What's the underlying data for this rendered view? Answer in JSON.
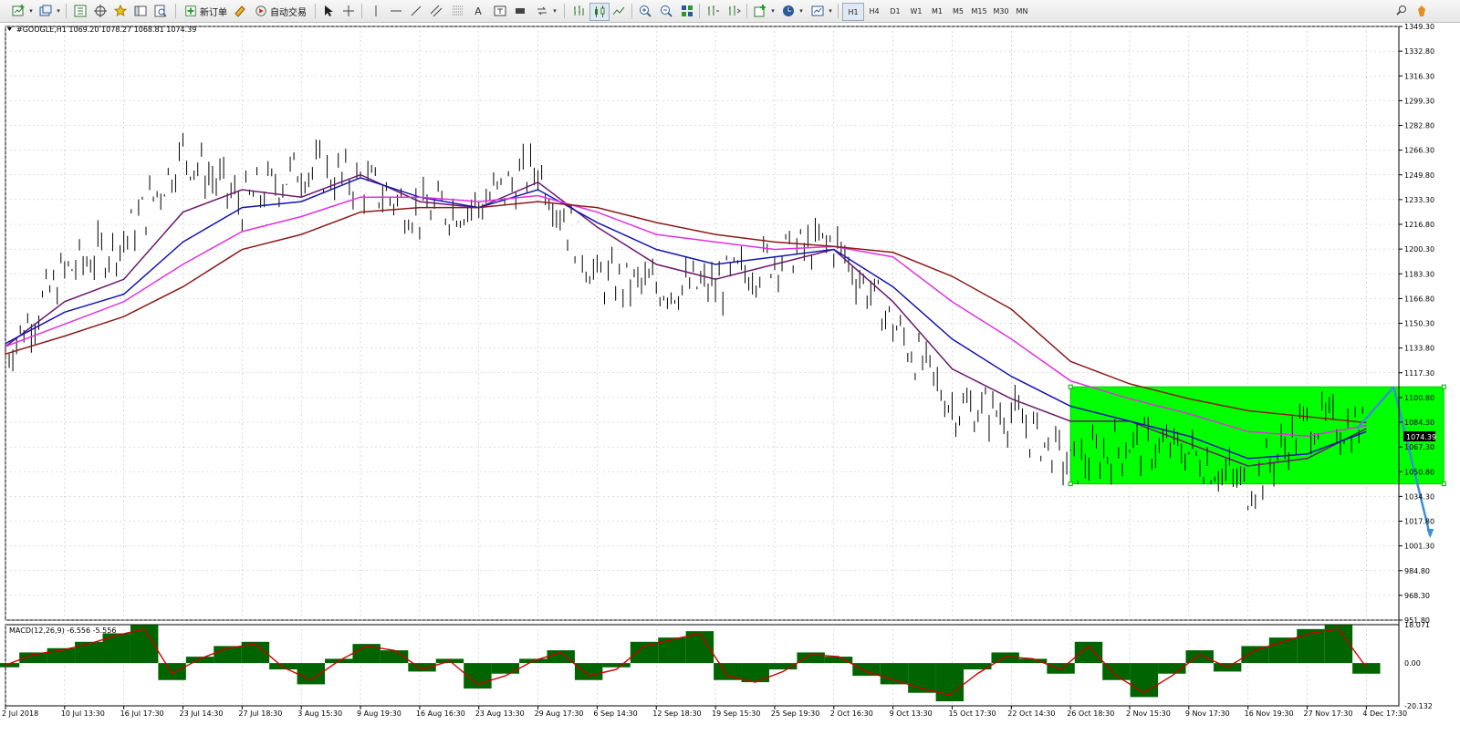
{
  "toolbar": {
    "new_order": "新订单",
    "auto_trading": "自动交易",
    "timeframes": [
      "H1",
      "H4",
      "D1",
      "W1",
      "M1",
      "M5",
      "M15",
      "M30",
      "MN"
    ],
    "active_timeframe": "H1"
  },
  "chart_legend": "#GOOGLE,H1  1069.20 1078.27 1068.81 1074.39",
  "macd_legend": "MACD(12,26,9) -6.556 -5.556",
  "current_price": "1074.39",
  "price_labels": [
    "1349.30",
    "1332.80",
    "1316.30",
    "1299.30",
    "1282.80",
    "1266.30",
    "1249.80",
    "1233.30",
    "1216.80",
    "1200.30",
    "1183.30",
    "1166.80",
    "1150.30",
    "1133.80",
    "1117.30",
    "1100.80",
    "1084.30",
    "1067.30",
    "1050.80",
    "1034.30",
    "1017.80",
    "1001.30",
    "984.80",
    "968.30",
    "951.80"
  ],
  "macd_labels": [
    "18.071",
    "0.00",
    "-20.132"
  ],
  "time_labels": [
    "2 Jul 2018",
    "10 Jul 13:30",
    "16 Jul 17:30",
    "23 Jul 14:30",
    "27 Jul 18:30",
    "3 Aug 15:30",
    "9 Aug 19:30",
    "16 Aug 16:30",
    "23 Aug 13:30",
    "29 Aug 17:30",
    "6 Sep 14:30",
    "12 Sep 18:30",
    "19 Sep 15:30",
    "25 Sep 19:30",
    "2 Oct 16:30",
    "9 Oct 13:30",
    "15 Oct 17:30",
    "22 Oct 14:30",
    "26 Oct 18:30",
    "2 Nov 15:30",
    "9 Nov 17:30",
    "16 Nov 19:30",
    "27 Nov 17:30",
    "4 Dec 17:30"
  ],
  "colors": {
    "price_bars": "#000000",
    "ma_fast": "#6b1a6b",
    "ma_mid": "#1515b0",
    "ma_slow": "#e030e0",
    "ma_long": "#8b1a1a",
    "range_box": "#00ff00",
    "arrow": "#3a8fd8",
    "macd_hist": "#006400",
    "macd_signal": "#cc0000",
    "grid": "#c0c0c0"
  },
  "chart_data": {
    "type": "line",
    "symbol": "#GOOGLE",
    "timeframe": "H1",
    "ohlc_last": {
      "open": 1069.2,
      "high": 1078.27,
      "low": 1068.81,
      "close": 1074.39
    },
    "ylim": [
      951.8,
      1349.3
    ],
    "grid": true,
    "x": [
      "2 Jul 2018",
      "10 Jul 13:30",
      "16 Jul 17:30",
      "23 Jul 14:30",
      "27 Jul 18:30",
      "3 Aug 15:30",
      "9 Aug 19:30",
      "16 Aug 16:30",
      "23 Aug 13:30",
      "29 Aug 17:30",
      "6 Sep 14:30",
      "12 Sep 18:30",
      "19 Sep 15:30",
      "25 Sep 19:30",
      "2 Oct 16:30",
      "9 Oct 13:30",
      "15 Oct 17:30",
      "22 Oct 14:30",
      "26 Oct 18:30",
      "2 Nov 15:30",
      "9 Nov 17:30",
      "16 Nov 19:30",
      "27 Nov 17:30",
      "4 Dec 17:30"
    ],
    "series": [
      {
        "values": [
          1130,
          1185,
          1205,
          1265,
          1230,
          1255,
          1245,
          1225,
          1230,
          1255,
          1180,
          1175,
          1175,
          1195,
          1205,
          1150,
          1095,
          1090,
          1055,
          1070,
          1065,
          1040,
          1085,
          1080
        ]
      },
      {
        "values": [
          1135,
          1165,
          1180,
          1225,
          1240,
          1235,
          1250,
          1232,
          1228,
          1245,
          1215,
          1190,
          1180,
          1190,
          1200,
          1165,
          1120,
          1100,
          1085,
          1085,
          1070,
          1055,
          1060,
          1080
        ]
      },
      {
        "values": [
          1137,
          1158,
          1170,
          1205,
          1228,
          1232,
          1248,
          1235,
          1228,
          1240,
          1218,
          1200,
          1190,
          1195,
          1200,
          1175,
          1140,
          1115,
          1095,
          1085,
          1075,
          1060,
          1063,
          1078
        ]
      },
      {
        "values": [
          1135,
          1150,
          1165,
          1190,
          1212,
          1222,
          1235,
          1235,
          1232,
          1236,
          1225,
          1210,
          1205,
          1200,
          1202,
          1195,
          1165,
          1140,
          1112,
          1100,
          1090,
          1078,
          1075,
          1082
        ]
      },
      {
        "values": [
          1130,
          1142,
          1155,
          1175,
          1200,
          1210,
          1225,
          1228,
          1228,
          1232,
          1228,
          1218,
          1210,
          1205,
          1202,
          1198,
          1182,
          1160,
          1125,
          1110,
          1100,
          1092,
          1088,
          1084
        ]
      }
    ],
    "range_box": {
      "from": "26 Oct 18:30",
      "to": "4 Dec 17:30",
      "high": 1108,
      "low": 1043
    },
    "projection": {
      "peak": 1108,
      "target": 1008
    },
    "macd": {
      "ylim": [
        -20.132,
        18.071
      ],
      "histogram": [
        -2,
        5,
        7,
        10,
        14,
        18,
        -8,
        3,
        8,
        10,
        -3,
        -10,
        2,
        9,
        6,
        -4,
        2,
        -12,
        -5,
        2,
        6,
        -8,
        -2,
        10,
        12,
        15,
        -8,
        -9,
        -3,
        5,
        3,
        -6,
        -10,
        -14,
        -18,
        -3,
        5,
        2,
        -5,
        10,
        -8,
        -16,
        -5,
        6,
        -4,
        8,
        12,
        16,
        18,
        -5
      ],
      "signal": [
        -1,
        4,
        6,
        9,
        13,
        16,
        -5,
        2,
        7,
        9,
        -2,
        -8,
        1,
        8,
        6,
        -3,
        1,
        -10,
        -6,
        1,
        5,
        -6,
        -3,
        8,
        11,
        14,
        -6,
        -9,
        -4,
        4,
        3,
        -4,
        -8,
        -12,
        -15,
        -5,
        3,
        2,
        -3,
        8,
        -6,
        -14,
        -6,
        4,
        -2,
        6,
        10,
        14,
        16,
        -2
      ]
    }
  }
}
